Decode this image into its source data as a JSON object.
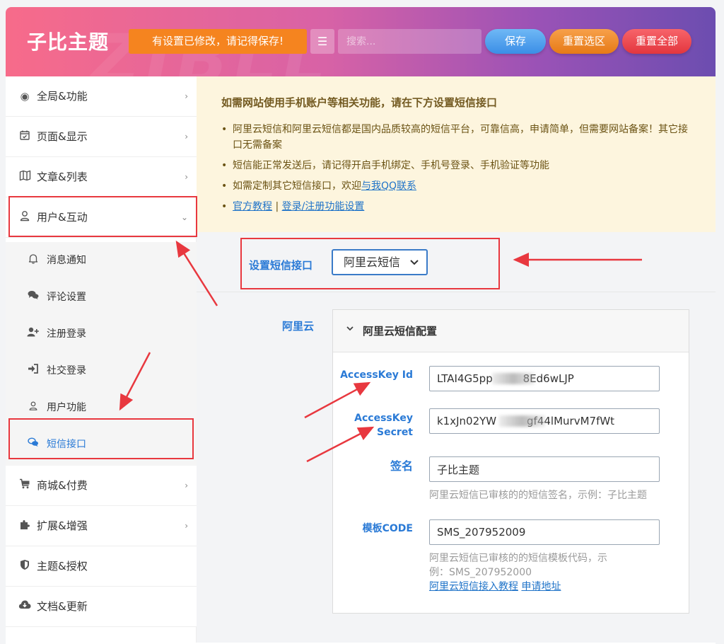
{
  "header": {
    "logo": "子比主题",
    "notice": "有设置已修改，请记得保存!",
    "search_placeholder": "搜索...",
    "save_label": "保存",
    "reset_section_label": "重置选区",
    "reset_all_label": "重置全部",
    "bg_watermark": "ZIBLL"
  },
  "sidebar": {
    "items": [
      {
        "label": "全局&功能",
        "icon": "radio-icon"
      },
      {
        "label": "页面&显示",
        "icon": "calendar-check-icon"
      },
      {
        "label": "文章&列表",
        "icon": "map-icon"
      },
      {
        "label": "用户&互动",
        "icon": "user-icon"
      },
      {
        "label": "商城&付费",
        "icon": "cart-icon"
      },
      {
        "label": "扩展&增强",
        "icon": "puzzle-icon"
      },
      {
        "label": "主题&授权",
        "icon": "shield-icon"
      },
      {
        "label": "文档&更新",
        "icon": "cloud-download-icon"
      }
    ],
    "subitems": [
      {
        "label": "消息通知",
        "icon": "bell-icon"
      },
      {
        "label": "评论设置",
        "icon": "comments-icon"
      },
      {
        "label": "注册登录",
        "icon": "user-plus-icon"
      },
      {
        "label": "社交登录",
        "icon": "sign-in-icon"
      },
      {
        "label": "用户功能",
        "icon": "user-icon"
      },
      {
        "label": "短信接口",
        "icon": "chat-icon"
      }
    ]
  },
  "info": {
    "title": "如需网站使用手机账户等相关功能，请在下方设置短信接口",
    "line1": "阿里云短信和阿里云短信都是国内品质较高的短信平台，可靠信高，申请简单，但需要网站备案！其它接口无需备案",
    "line2": "短信能正常发送后，请记得开启手机绑定、手机号登录、手机验证等功能",
    "line3_prefix": "如需定制其它短信接口，欢迎",
    "line3_link": "与我QQ联系",
    "link_tutorial": "官方教程",
    "separator": "|",
    "link_login": "登录/注册功能设置"
  },
  "sms": {
    "type_label": "设置短信接口",
    "type_value": "阿里云短信",
    "provider_label": "阿里云",
    "card_title": "阿里云短信配置",
    "fields": {
      "access_key_id_label": "AccessKey Id",
      "access_key_id_value": "LTAI4G5pp         8Ed6wLJP",
      "access_key_secret_label_1": "AccessKey",
      "access_key_secret_label_2": "Secret",
      "access_key_secret_value": "k1xJn02YW         gf44lMurvM7fWt",
      "sign_label": "签名",
      "sign_value": "子比主题",
      "sign_help": "阿里云短信已审核的的短信签名，示例：子比主题",
      "template_label": "模板CODE",
      "template_value": "SMS_207952009",
      "template_help_1": "阿里云短信已审核的的短信模板代码，示",
      "template_help_2": "例：SMS_207952000",
      "link_tutorial": "阿里云短信接入教程",
      "link_apply": "申请地址"
    }
  },
  "colors": {
    "accent": "#2a7ad6",
    "annotation": "#e8383f",
    "notice": "#f5841f"
  }
}
